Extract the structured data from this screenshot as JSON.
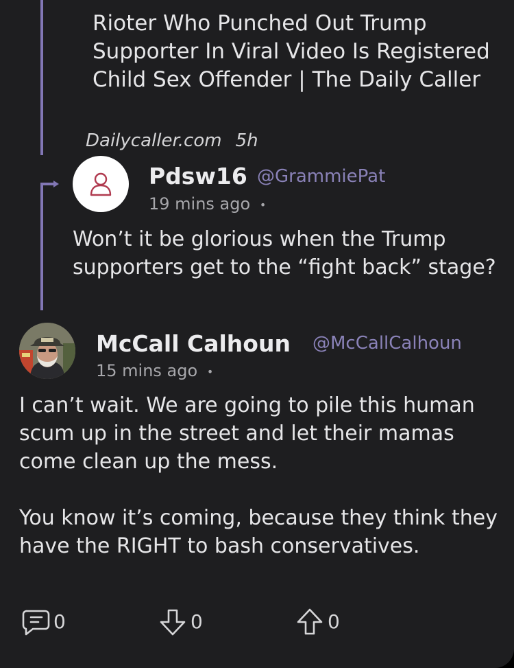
{
  "shared_article": {
    "title": "Rioter Who Punched Out Trump Supporter In Viral Video Is Registered Child Sex Offender | The Daily Caller",
    "source": "Dailycaller.com",
    "age": "5h"
  },
  "reply_post": {
    "display_name": "Pdsw16",
    "handle": "@GrammiePat",
    "timestamp": "19 mins ago",
    "separator": "•",
    "avatar_icon": "user-outline-icon",
    "body": "Won’t it be glorious when the Trump supporters get to the “fight back” stage?"
  },
  "main_post": {
    "display_name": "McCall Calhoun",
    "handle": "@McCallCalhoun",
    "timestamp": "15 mins ago",
    "separator": "•",
    "body_paragraphs": [
      "I can’t wait. We are going to pile this human scum up in the street and let their mamas come clean up the mess.",
      "You know it’s coming, because they think they have the RIGHT to bash conservatives."
    ]
  },
  "actions": {
    "comments": {
      "icon": "comment-icon",
      "count": "0"
    },
    "downvotes": {
      "icon": "downvote-arrow-icon",
      "count": "0"
    },
    "upvotes": {
      "icon": "upvote-arrow-icon",
      "count": "0"
    }
  },
  "colors": {
    "background": "#1e1e20",
    "thread_line": "#8277b5",
    "handle": "#8a82b8",
    "text": "#e6e6e8",
    "muted": "#a7a7ab",
    "avatar_outline": "#b03a4f"
  }
}
